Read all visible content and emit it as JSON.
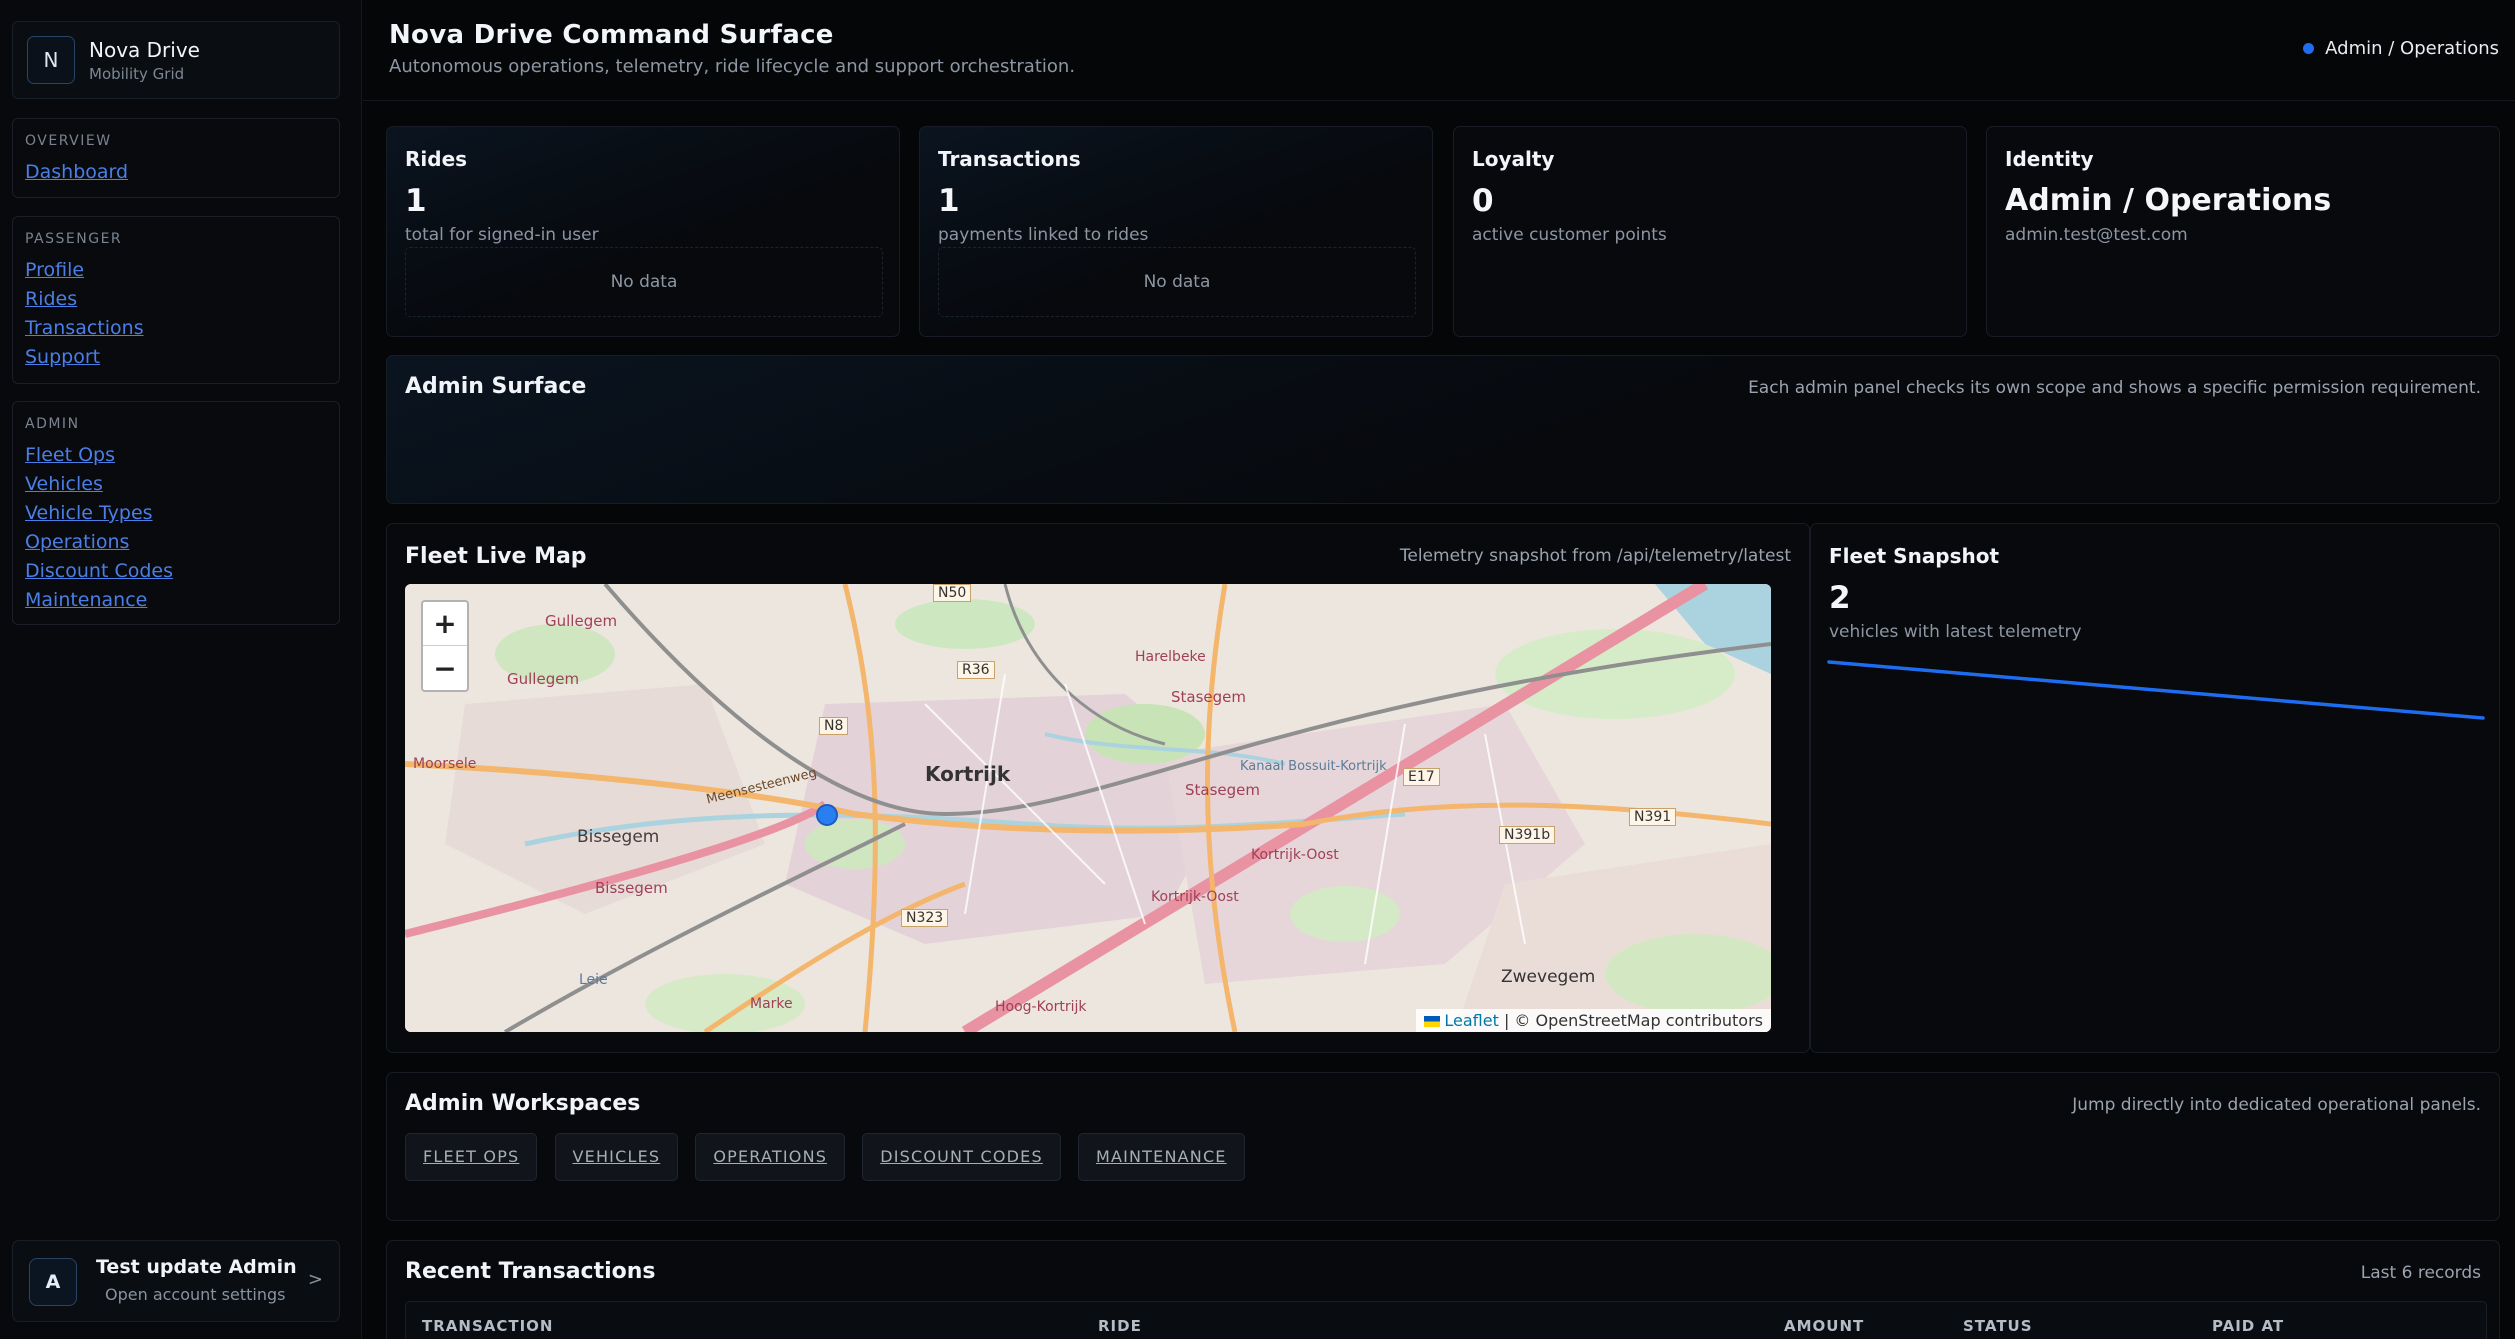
{
  "brand": {
    "initial": "N",
    "name": "Nova Drive",
    "subtitle": "Mobility Grid"
  },
  "nav": {
    "overview": {
      "title": "OVERVIEW",
      "items": [
        "Dashboard"
      ]
    },
    "passenger": {
      "title": "PASSENGER",
      "items": [
        "Profile",
        "Rides",
        "Transactions",
        "Support"
      ]
    },
    "admin": {
      "title": "ADMIN",
      "items": [
        "Fleet Ops",
        "Vehicles",
        "Vehicle Types",
        "Operations",
        "Discount Codes",
        "Maintenance"
      ]
    }
  },
  "user": {
    "initial": "A",
    "name": "Test update Admin",
    "subtitle": "Open account settings",
    "chevron": ">"
  },
  "header": {
    "title": "Nova Drive Command Surface",
    "subtitle": "Autonomous operations, telemetry, ride lifecycle and support orchestration.",
    "role": "Admin / Operations"
  },
  "stats": {
    "rides": {
      "title": "Rides",
      "value": "1",
      "caption": "total for signed-in user",
      "empty": "No data"
    },
    "transactions": {
      "title": "Transactions",
      "value": "1",
      "caption": "payments linked to rides",
      "empty": "No data"
    },
    "loyalty": {
      "title": "Loyalty",
      "value": "0",
      "caption": "active customer points"
    },
    "identity": {
      "title": "Identity",
      "value": "Admin / Operations",
      "caption": "admin.test@test.com"
    }
  },
  "admin_surface": {
    "title": "Admin Surface",
    "note": "Each admin panel checks its own scope and shows a specific permission requirement."
  },
  "fleet_map": {
    "title": "Fleet Live Map",
    "note": "Telemetry snapshot from /api/telemetry/latest",
    "zoom_in": "+",
    "zoom_out": "−",
    "attribution_link": "Leaflet",
    "attribution_text": "| © OpenStreetMap contributors",
    "labels": {
      "kortrijk": "Kortrijk",
      "bissegem": "Bissegem",
      "bissegem11": "Bissegem",
      "stasegem": "Stasegem",
      "stasegem2": "Stasegem",
      "harelbeke": "Harelbeke",
      "gullegem": "Gullegem",
      "gullegem9": "Gullegem",
      "moorsele": "Moorsele",
      "zwevegem": "Zwevegem",
      "kortrijk_oost": "Kortrijk-Oost",
      "kortrijk_oost2": "Kortrijk-Oost",
      "hoog_kortrijk": "Hoog-Kortrijk",
      "marke": "Marke",
      "leie": "Leie",
      "meensesteenweg": "Meensesteenweg",
      "kanaal": "Kanaal Bossuit-Kortrijk",
      "r36": "R36",
      "n8": "N8",
      "n50": "N50",
      "n323": "N323",
      "e17": "E17",
      "n391b": "N391b",
      "n391": "N391"
    },
    "marker_color": "#2a7ff0"
  },
  "fleet_snapshot": {
    "title": "Fleet Snapshot",
    "value": "2",
    "caption": "vehicles with latest telemetry",
    "line_color": "#1e6df0"
  },
  "workspaces": {
    "title": "Admin Workspaces",
    "note": "Jump directly into dedicated operational panels.",
    "chips": [
      "FLEET OPS",
      "VEHICLES",
      "OPERATIONS",
      "DISCOUNT CODES",
      "MAINTENANCE"
    ]
  },
  "recent_transactions": {
    "title": "Recent Transactions",
    "note": "Last 6 records",
    "columns": [
      "TRANSACTION",
      "RIDE",
      "AMOUNT",
      "STATUS",
      "PAID AT"
    ]
  }
}
